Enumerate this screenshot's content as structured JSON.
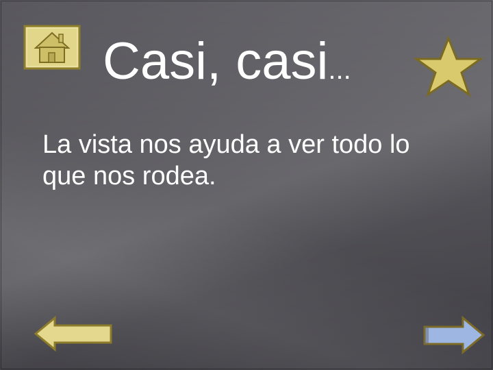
{
  "slide": {
    "title": "Casi, casi",
    "title_ellipsis": "...",
    "body": "La vista nos ayuda a ver todo lo que nos rodea."
  },
  "icons": {
    "home": "home-icon",
    "star": "star-icon",
    "back": "arrow-left-icon",
    "next": "arrow-right-icon"
  },
  "colors": {
    "text": "#ffffff",
    "button_fill": "#e4d88c",
    "button_border": "#8a7a2a",
    "next_fill": "#9cb4e0",
    "next_border": "#7a6a2a"
  }
}
